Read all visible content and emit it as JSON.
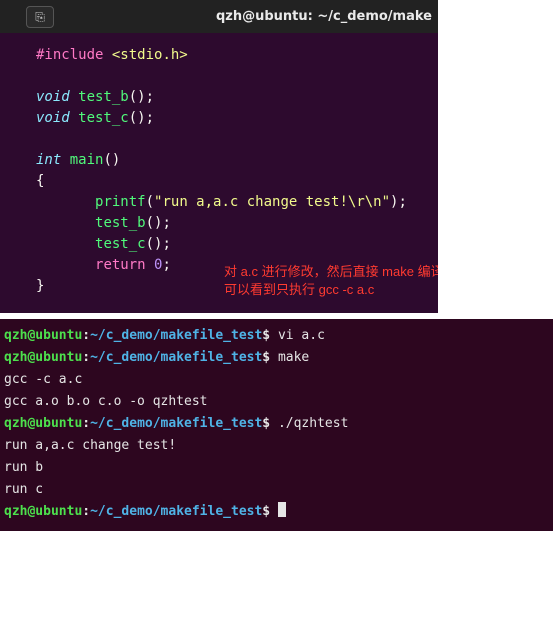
{
  "titlebar": {
    "title": "qzh@ubuntu: ~/c_demo/make",
    "button_icon": "⎘"
  },
  "code": {
    "line1_include": "#include",
    "line1_space": " ",
    "line1_header": "<stdio.h>",
    "blank": "",
    "void1": "void",
    "fn_b": " test_b",
    "paren_empty": "()",
    "semi": ";",
    "void2": "void",
    "fn_c": " test_c",
    "int_kw": "int",
    "main_fn": " main",
    "open_brace": "{",
    "indent": "       ",
    "printf_name": "printf",
    "printf_open": "(",
    "printf_str": "\"run a,a.c change test!\\r\\n\"",
    "printf_close": ")",
    "call_b": "test_b",
    "call_c": "test_c",
    "return_kw": "return",
    "zero": " 0",
    "close_brace": "}"
  },
  "annotation": {
    "line1": "对 a.c 进行修改，然后直接 make 编译",
    "line2": "可以看到只执行 gcc -c a.c"
  },
  "prompt": {
    "user": "qzh@ubuntu",
    "colon": ":",
    "path": "~/c_demo/makefile_test",
    "dollar": "$"
  },
  "term": {
    "cmd1": " vi a.c",
    "cmd2": " make",
    "out1": "gcc -c a.c",
    "out2": "gcc a.o b.o c.o -o qzhtest",
    "cmd3": " ./qzhtest",
    "out3": "run a,a.c change test!",
    "out4": "run b",
    "out5": "run c",
    "cmd4_space": " "
  }
}
